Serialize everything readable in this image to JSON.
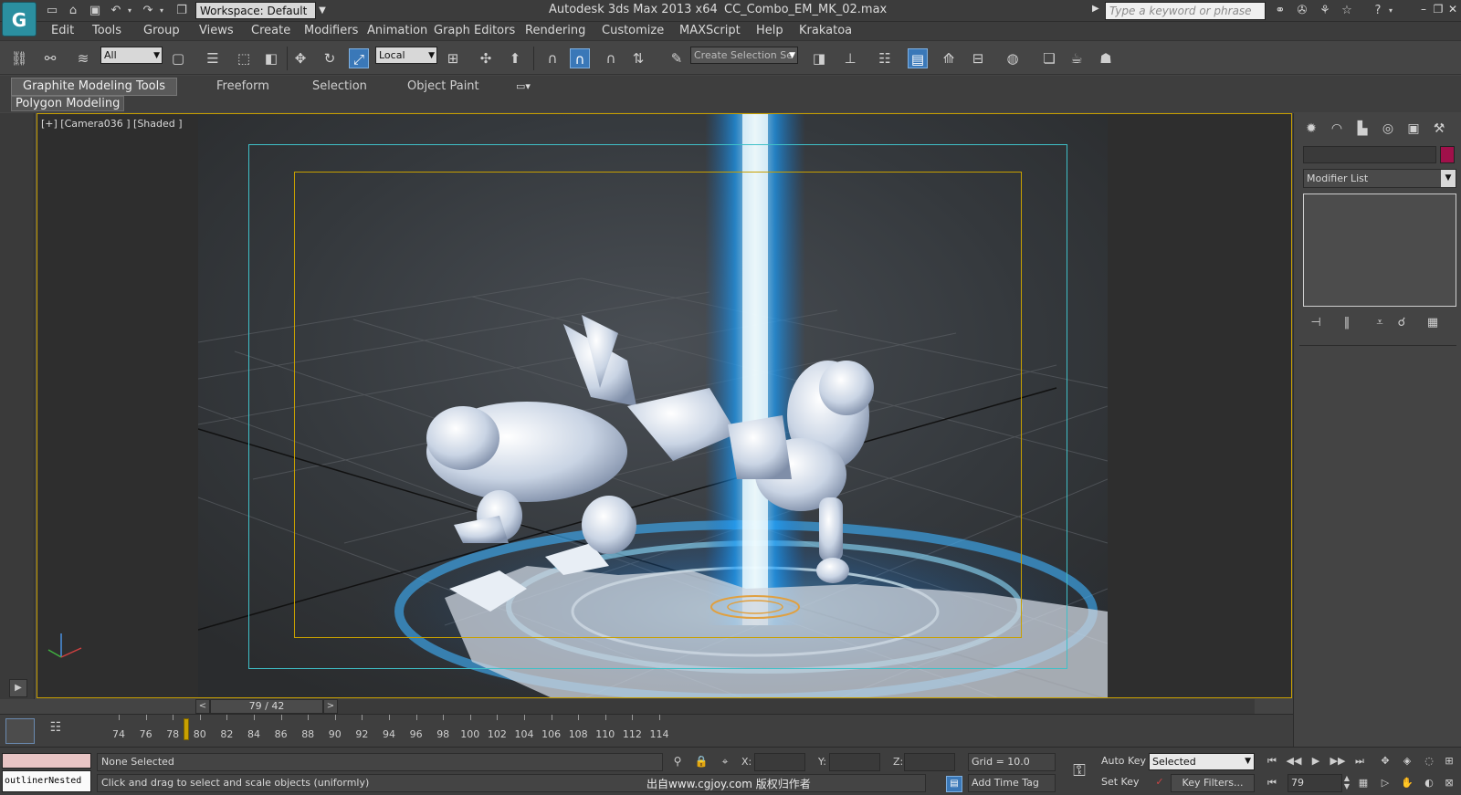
{
  "titlebar": {
    "logo_text": "G",
    "workspace": "Workspace: Default",
    "app_title": "Autodesk 3ds Max  2013 x64",
    "file_title": "CC_Combo_EM_MK_02.max",
    "search_placeholder": "Type a keyword or phrase",
    "quick_access_icons": [
      "new-file-icon",
      "open-file-icon",
      "save-icon",
      "undo-icon",
      "redo-icon",
      "project-folder-icon"
    ],
    "info_icons": [
      "binoculars-icon",
      "tools-icon",
      "star-icon",
      "help-icon"
    ],
    "window_controls": [
      "minimize-icon",
      "restore-icon",
      "close-icon"
    ]
  },
  "menu": {
    "items": [
      "Edit",
      "Tools",
      "Group",
      "Views",
      "Create",
      "Modifiers",
      "Animation",
      "Graph Editors",
      "Rendering",
      "Customize",
      "MAXScript",
      "Help",
      "Krakatoa"
    ]
  },
  "toolbar": {
    "selection_filter": "All",
    "reference_coord": "Local",
    "named_selection_placeholder": "Create Selection Se",
    "active_tool": "select-and-uniform-scale"
  },
  "ribbon": {
    "tabs": [
      "Graphite Modeling Tools",
      "Freeform",
      "Selection",
      "Object Paint"
    ],
    "active_tab": "Graphite Modeling Tools",
    "panel_label": "Polygon Modeling"
  },
  "viewport": {
    "label": "[+] [Camera036 ] [Shaded ]",
    "border_color": "#c8a000",
    "safe_frame_outer_color": "#3fc0c8",
    "safe_frame_inner_color": "#c8a000"
  },
  "time_slider": {
    "position_text": "79 / 42",
    "prev": "<",
    "next": ">"
  },
  "trackbar": {
    "ticks": [
      74,
      76,
      78,
      80,
      82,
      84,
      86,
      88,
      90,
      92,
      94,
      96,
      98,
      100,
      102,
      104,
      106,
      108,
      110,
      112,
      114
    ],
    "current_frame": 79
  },
  "command_panel": {
    "tabs": [
      "create-tab-icon",
      "modify-tab-icon",
      "hierarchy-tab-icon",
      "motion-tab-icon",
      "display-tab-icon",
      "utilities-tab-icon"
    ],
    "modifier_list": "Modifier List",
    "object_color": "#a0104a",
    "stack_buttons": [
      "pin-stack-icon",
      "show-end-result-icon",
      "make-unique-icon",
      "remove-modifier-icon",
      "configure-sets-icon"
    ]
  },
  "status": {
    "script_output": "outlinerNested",
    "selection": "None Selected",
    "prompt": "Click and drag to select and scale objects (uniformly)",
    "watermark": "出自www.cgjoy.com 版权归作者",
    "x_label": "X:",
    "y_label": "Y:",
    "z_label": "Z:",
    "grid": "Grid = 10.0",
    "add_time_tag": "Add Time Tag",
    "auto_key": "Auto Key",
    "set_key": "Set Key",
    "key_mode": "Selected",
    "key_filters": "Key Filters...",
    "frame": "79"
  }
}
